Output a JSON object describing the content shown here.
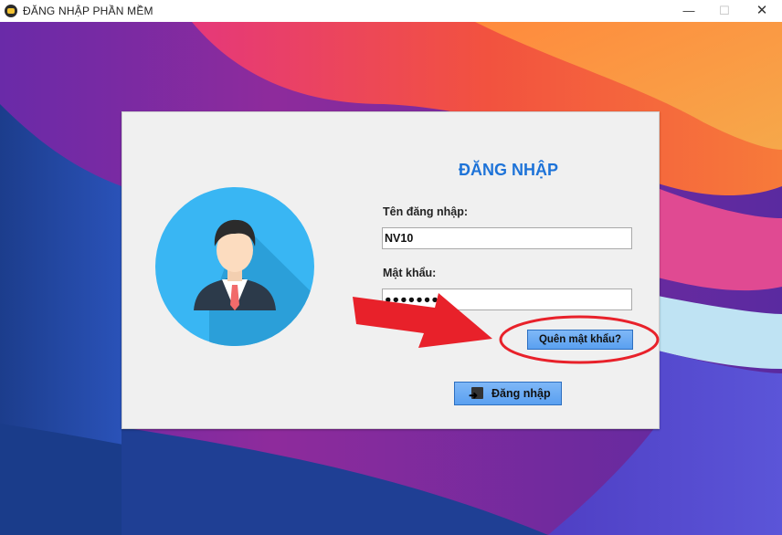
{
  "window": {
    "title": "ĐĂNG NHẬP PHẦN MỀM",
    "minimize": "—",
    "maximize": "☐",
    "close": "✕"
  },
  "form": {
    "heading": "ĐĂNG NHẬP",
    "username_label": "Tên đăng nhập:",
    "username_value": "NV10",
    "password_label": "Mật khẩu:",
    "password_value": "●●●●●●●",
    "forgot_label": "Quên mật khẩu?",
    "login_label": "Đăng nhập"
  },
  "annotation": {
    "arrow_color": "#e8212a",
    "circle_color": "#e8212a"
  }
}
